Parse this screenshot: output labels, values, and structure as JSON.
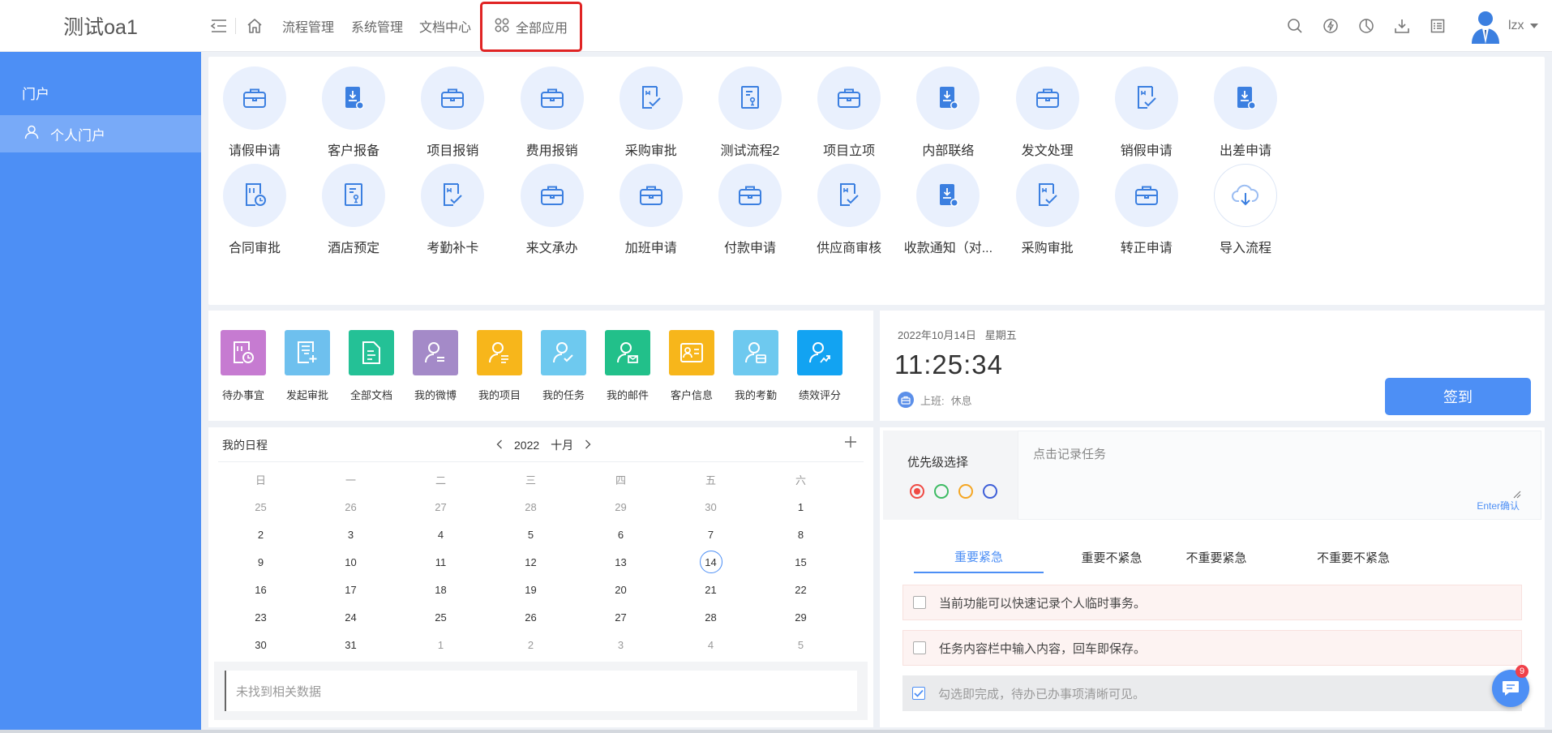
{
  "app": {
    "title": "测试oa1",
    "nav": [
      "流程管理",
      "系统管理",
      "文档中心"
    ],
    "all_apps": "全部应用",
    "username": "lzx"
  },
  "sidebar": {
    "section": "门户",
    "items": [
      {
        "label": "个人门户"
      }
    ]
  },
  "apps": {
    "row1": [
      {
        "label": "请假申请",
        "icon": "briefcase-icon"
      },
      {
        "label": "客户报备",
        "icon": "doc-download-icon"
      },
      {
        "label": "项目报销",
        "icon": "briefcase-icon"
      },
      {
        "label": "费用报销",
        "icon": "briefcase-icon"
      },
      {
        "label": "采购审批",
        "icon": "doc-check-icon"
      },
      {
        "label": "测试流程2",
        "icon": "doc-person-icon"
      },
      {
        "label": "项目立项",
        "icon": "briefcase-icon"
      },
      {
        "label": "内部联络",
        "icon": "doc-download-icon"
      },
      {
        "label": "发文处理",
        "icon": "briefcase-icon"
      },
      {
        "label": "销假申请",
        "icon": "doc-check-icon"
      },
      {
        "label": "出差申请",
        "icon": "doc-download-icon"
      }
    ],
    "row2": [
      {
        "label": "合同审批",
        "icon": "doc-clock-icon"
      },
      {
        "label": "酒店预定",
        "icon": "doc-person-icon"
      },
      {
        "label": "考勤补卡",
        "icon": "doc-check-icon"
      },
      {
        "label": "来文承办",
        "icon": "briefcase-icon"
      },
      {
        "label": "加班申请",
        "icon": "briefcase-icon"
      },
      {
        "label": "付款申请",
        "icon": "briefcase-icon"
      },
      {
        "label": "供应商审核",
        "icon": "doc-check-icon"
      },
      {
        "label": "收款通知（对...",
        "icon": "doc-download-icon"
      },
      {
        "label": "采购审批",
        "icon": "doc-check-icon"
      },
      {
        "label": "转正申请",
        "icon": "briefcase-icon"
      },
      {
        "label": "导入流程",
        "icon": "cloud-download-icon"
      }
    ]
  },
  "tiles": [
    {
      "label": "待办事宜",
      "color": "#c67bd1"
    },
    {
      "label": "发起审批",
      "color": "#6ec0ee"
    },
    {
      "label": "全部文档",
      "color": "#24c196"
    },
    {
      "label": "我的微博",
      "color": "#a48ac8"
    },
    {
      "label": "我的项目",
      "color": "#f7b61b"
    },
    {
      "label": "我的任务",
      "color": "#6ec9ef"
    },
    {
      "label": "我的邮件",
      "color": "#22c08a"
    },
    {
      "label": "客户信息",
      "color": "#f7b61b"
    },
    {
      "label": "我的考勤",
      "color": "#6ec9ef"
    },
    {
      "label": "绩效评分",
      "color": "#12a3f2"
    }
  ],
  "clock": {
    "date": "2022年10月14日",
    "weekday": "星期五",
    "time": "11:25:34",
    "status_label": "上班:",
    "status_value": "休息",
    "sign_button": "签到"
  },
  "calendar": {
    "title": "我的日程",
    "year": "2022",
    "month": "十月",
    "weekdays": [
      "日",
      "一",
      "二",
      "三",
      "四",
      "五",
      "六"
    ],
    "weeks": [
      [
        "25",
        "26",
        "27",
        "28",
        "29",
        "30",
        "1"
      ],
      [
        "2",
        "3",
        "4",
        "5",
        "6",
        "7",
        "8"
      ],
      [
        "9",
        "10",
        "11",
        "12",
        "13",
        "14",
        "15"
      ],
      [
        "16",
        "17",
        "18",
        "19",
        "20",
        "21",
        "22"
      ],
      [
        "23",
        "24",
        "25",
        "26",
        "27",
        "28",
        "29"
      ],
      [
        "30",
        "31",
        "1",
        "2",
        "3",
        "4",
        "5"
      ]
    ],
    "today": "14",
    "empty_text": "未找到相关数据"
  },
  "tasks": {
    "priority_title": "优先级选择",
    "priority_colors": [
      "#f04a44",
      "#3dbb63",
      "#f5a623",
      "#3e5fd8"
    ],
    "input_placeholder": "点击记录任务",
    "enter_hint": "Enter确认",
    "tabs": [
      "重要紧急",
      "重要不紧急",
      "不重要紧急",
      "不重要不紧急"
    ],
    "items": [
      {
        "text": "当前功能可以快速记录个人临时事务。",
        "done": false
      },
      {
        "text": "任务内容栏中输入内容，回车即保存。",
        "done": false
      },
      {
        "text": "勾选即完成，待办已办事项清晰可见。",
        "done": true
      }
    ]
  },
  "chat": {
    "badge": "9"
  }
}
